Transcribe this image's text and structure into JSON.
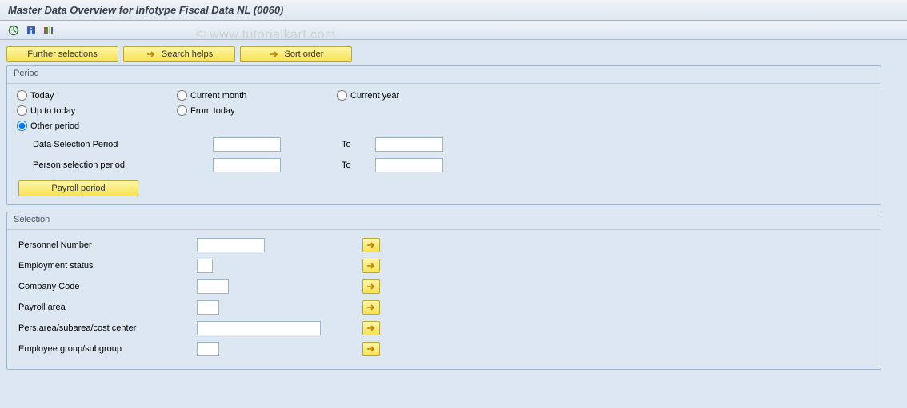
{
  "header": {
    "title": "Master Data Overview for Infotype Fiscal Data NL (0060)"
  },
  "watermark": "© www.tutorialkart.com",
  "toolbar_buttons": {
    "further_selections": "Further selections",
    "search_helps": "Search helps",
    "sort_order": "Sort order"
  },
  "period": {
    "legend": "Period",
    "opt_today": "Today",
    "opt_current_month": "Current month",
    "opt_current_year": "Current year",
    "opt_up_to_today": "Up to today",
    "opt_from_today": "From today",
    "opt_other_period": "Other period",
    "selected": "other_period",
    "data_selection_period_label": "Data Selection Period",
    "data_selection_from": "",
    "data_selection_to_label": "To",
    "data_selection_to": "",
    "person_selection_period_label": "Person selection period",
    "person_selection_from": "",
    "person_selection_to_label": "To",
    "person_selection_to": "",
    "payroll_button": "Payroll period"
  },
  "selection": {
    "legend": "Selection",
    "rows": {
      "personnel_number": {
        "label": "Personnel Number",
        "value": ""
      },
      "employment_status": {
        "label": "Employment status",
        "value": ""
      },
      "company_code": {
        "label": "Company Code",
        "value": ""
      },
      "payroll_area": {
        "label": "Payroll area",
        "value": ""
      },
      "pers_area": {
        "label": "Pers.area/subarea/cost center",
        "value": ""
      },
      "employee_group": {
        "label": "Employee group/subgroup",
        "value": ""
      }
    }
  }
}
